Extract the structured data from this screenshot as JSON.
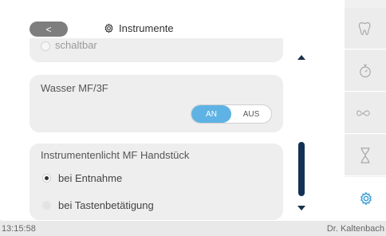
{
  "header": {
    "back_label": "<",
    "title": "Instrumente",
    "title_icon": "gear-icon"
  },
  "cards": {
    "top_partial_option": "schaltbar",
    "water": {
      "label": "Wasser MF/3F",
      "toggle_on": "AN",
      "toggle_off": "AUS",
      "selected": "AN"
    },
    "instrument_light": {
      "label": "Instrumentenlicht MF Handstück",
      "options": [
        "bei Entnahme",
        "bei Tastenbetätigung"
      ],
      "selected_index": 0
    }
  },
  "sidebar": {
    "items": [
      {
        "icon": "tooth-icon"
      },
      {
        "icon": "timer-icon"
      },
      {
        "icon": "infinity-icon"
      },
      {
        "icon": "hourglass-icon"
      },
      {
        "icon": "gear-icon"
      }
    ],
    "active_index": 4
  },
  "statusbar": {
    "time": "13:15:58",
    "user": "Dr. Kaltenbach"
  },
  "colors": {
    "accent": "#5eb3e4",
    "scroll": "#143056",
    "active_icon": "#3d9fd6"
  }
}
